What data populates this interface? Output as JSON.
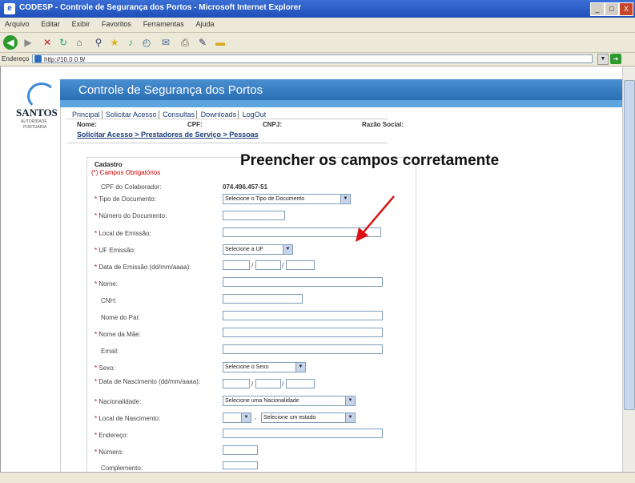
{
  "window": {
    "title": "CODESP - Controle de Segurança dos Portos - Microsoft Internet Explorer",
    "buttons": {
      "minimize": "_",
      "maximize": "□",
      "close": "X"
    }
  },
  "menu": [
    "Arquivo",
    "Editar",
    "Exibir",
    "Favoritos",
    "Ferramentas",
    "Ajuda"
  ],
  "address": {
    "label": "Endereço",
    "url": "http://10.0.0.9/"
  },
  "app": {
    "banner_title": "Controle de Segurança dos Portos",
    "logo": "SANTOS",
    "logo_sub": "AUTORIDADE",
    "logo_sub2": "PORTUÁRIA"
  },
  "nav": [
    "Principal",
    "Solicitar Acesso",
    "Consultas",
    "Downloads",
    "LogOut"
  ],
  "info": {
    "nome": "Nome:",
    "cpf": "CPF:",
    "cnpj": "CNPJ:",
    "razao": "Razão Social:"
  },
  "breadcrumb": "Solicitar Acesso > Prestadores de Serviço > Pessoas",
  "form": {
    "title": "Cadastro",
    "required_note": "(*) Campos Obrigatórios",
    "cpf_label": "CPF do Colaborador:",
    "cpf_value": "074.496.457-51",
    "fields": {
      "tipo_doc": {
        "label": "Tipo de Documento:",
        "value": "Selecione o Tipo de Documento"
      },
      "numero_doc": {
        "label": "Número do Documento:"
      },
      "local_emissao": {
        "label": "Local de Emissão:"
      },
      "uf_emissao": {
        "label": "UF Emissão:",
        "value": "Selecione a UF"
      },
      "data_emissao": {
        "label": "Data de Emissão (dd/mm/aaaa):"
      },
      "nome": {
        "label": "Nome:"
      },
      "cnh": {
        "label": "CNH:"
      },
      "nome_pai": {
        "label": "Nome do Pai:"
      },
      "nome_mae": {
        "label": "Nome da Mãe:"
      },
      "email": {
        "label": "Email:"
      },
      "sexo": {
        "label": "Sexo:",
        "value": "Selecione o Sexo"
      },
      "data_nasc": {
        "label": "Data de Nascimento (dd/mm/aaaa):"
      },
      "nacionalidade": {
        "label": "Nacionalidade:",
        "value": "Selecione uma Nacionalidade"
      },
      "local_nasc": {
        "label": "Local de Nascimento:",
        "value": "Selecione um estado"
      },
      "endereco": {
        "label": "Endereço:"
      },
      "numero": {
        "label": "Número:"
      },
      "complemento": {
        "label": "Complemento:"
      }
    },
    "required_mark": "*"
  },
  "callout": "Preencher os campos corretamente",
  "colors": {
    "accent": "#2a6eb6",
    "required": "#cc0000",
    "arrow": "#dd1111"
  }
}
